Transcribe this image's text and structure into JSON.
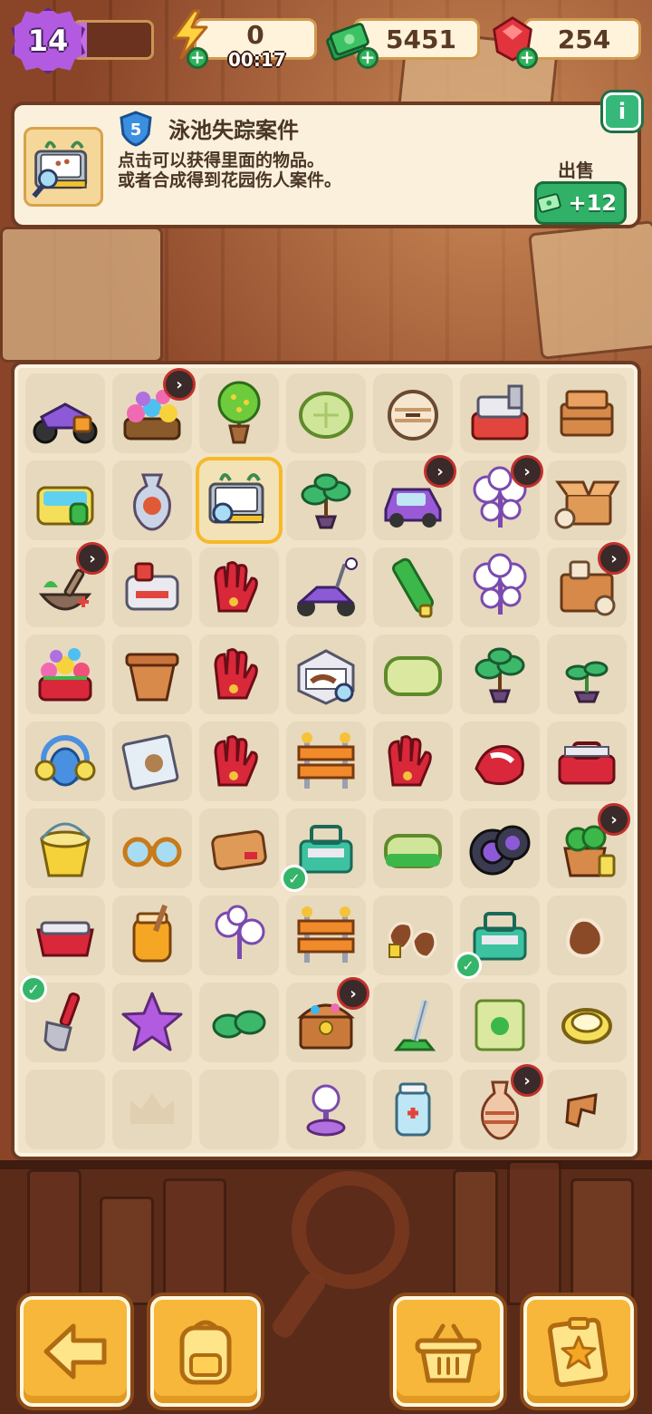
{
  "topbar": {
    "level": "14",
    "xp_progress": 0.15,
    "energy": "0",
    "energy_timer": "00:17",
    "cash": "5451",
    "gems": "254",
    "energy_icon": "lightning-icon",
    "cash_icon": "cash-stack-icon",
    "gem_icon": "red-gem-icon"
  },
  "info_card": {
    "level_badge": "5",
    "title": "泳池失踪案件",
    "description_line1": "点击可以获得里面的物品。",
    "description_line2": "或者合成得到花园伤人案件。",
    "sell_label": "出售",
    "sell_value": "+12",
    "info_button": "i"
  },
  "board": {
    "rows": [
      [
        "motorbike",
        "flower-box",
        "bonsai-tree",
        "cucumber-slice",
        "bandaged-ball",
        "shredder",
        "wood-crates"
      ],
      [
        "pool-box",
        "vase",
        "case-file",
        "bonsai-sprout",
        "purple-car",
        "lamp-tree",
        "open-box"
      ],
      [
        "mortar-pestle",
        "shredder-machine",
        "red-gloves",
        "purple-scooter",
        "green-tube",
        "lamp-tree",
        "cabinet-box"
      ],
      [
        "flower-basket",
        "clay-pot",
        "red-gloves",
        "evidence-board",
        "soap-bar",
        "bonsai-sprout",
        "seedling"
      ],
      [
        "gas-mask",
        "evidence-bag",
        "red-gloves",
        "road-barrier",
        "red-gloves",
        "rag-cloth",
        "toolbox-red"
      ],
      [
        "bucket",
        "sunglasses",
        "leather-wallet",
        "toolkit-green",
        "sponge",
        "tire",
        "potted-plant"
      ],
      [
        "red-tray",
        "honey-jar",
        "lamp-sprout",
        "road-barrier",
        "clue-prints",
        "toolkit-green",
        "clue-print"
      ],
      [
        "shovel",
        "purple-star",
        "sprout-leaves",
        "treasure-chest",
        "vacuum",
        "seed-bag",
        "yellow-ring"
      ],
      [
        "",
        "crown-ghost",
        "",
        "lamp-base",
        "medicine-jar",
        "pottery-vase",
        "broken-pot"
      ]
    ],
    "locks": [
      [
        0,
        1
      ],
      [
        1,
        4
      ],
      [
        1,
        5
      ],
      [
        2,
        0
      ],
      [
        2,
        6
      ],
      [
        5,
        6
      ],
      [
        7,
        3
      ],
      [
        8,
        5
      ]
    ],
    "checks": [
      [
        5,
        3
      ],
      [
        6,
        5
      ],
      [
        7,
        0
      ]
    ],
    "selected": [
      1,
      2
    ]
  },
  "bottom_bar": {
    "back_icon": "arrow-left-icon",
    "backpack_icon": "backpack-icon",
    "basket_icon": "basket-icon",
    "casebook_icon": "casebook-star-icon"
  },
  "colors": {
    "accent_orange": "#f7b73a",
    "green": "#31b067",
    "purple": "#b35be0",
    "brown": "#6d3b22"
  }
}
